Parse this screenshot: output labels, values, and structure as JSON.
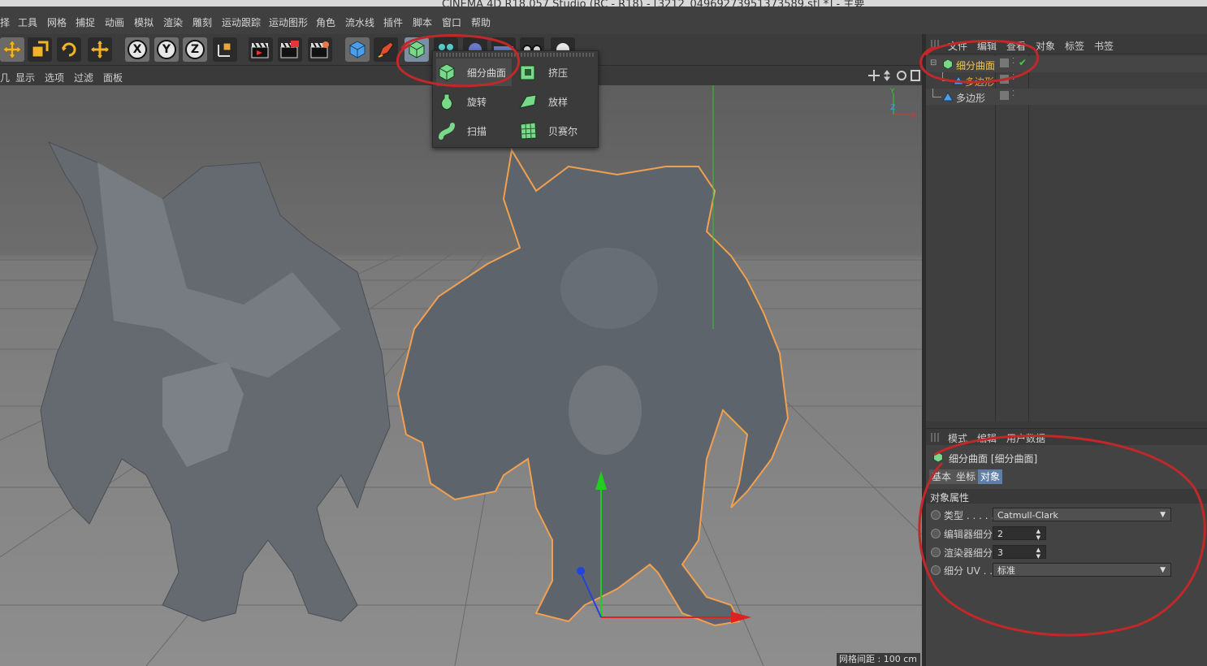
{
  "window": {
    "title": "CINEMA 4D R18.057 Studio (RC - R18) - [3212_04969273951373589.stl *] - 主要"
  },
  "menubar": {
    "items": [
      "择",
      "工具",
      "网格",
      "捕捉",
      "动画",
      "模拟",
      "渲染",
      "雕刻",
      "运动跟踪",
      "运动图形",
      "角色",
      "流水线",
      "插件",
      "脚本",
      "窗口",
      "帮助"
    ]
  },
  "viewport_menu": {
    "items": [
      "几",
      "显示",
      "选项",
      "过滤",
      "面板"
    ]
  },
  "popup": {
    "items": [
      {
        "label": "细分曲面",
        "icon": "subdivision-surface-icon"
      },
      {
        "label": "挤压",
        "icon": "extrude-icon"
      },
      {
        "label": "旋转",
        "icon": "lathe-icon"
      },
      {
        "label": "放样",
        "icon": "loft-icon"
      },
      {
        "label": "扫描",
        "icon": "sweep-icon"
      },
      {
        "label": "贝赛尔",
        "icon": "bezier-icon"
      }
    ]
  },
  "object_manager": {
    "menu": [
      "文件",
      "编辑",
      "查看",
      "对象",
      "标签",
      "书签"
    ],
    "objects": [
      {
        "label": "细分曲面",
        "color": "#f0c84a"
      },
      {
        "label": "多边形",
        "color": "#e0a040"
      },
      {
        "label": "多边形",
        "color": "#cfcfcf"
      }
    ]
  },
  "attribute_manager": {
    "menu": [
      "模式",
      "编辑",
      "用户数据"
    ],
    "object_title": "细分曲面 [细分曲面]",
    "tabs": [
      "基本",
      "坐标",
      "对象"
    ],
    "section_title": "对象属性",
    "properties": [
      {
        "label": "类型 . . . . .",
        "value": "Catmull-Clark",
        "kind": "dropdown"
      },
      {
        "label": "编辑器细分",
        "value": "2",
        "kind": "number"
      },
      {
        "label": "渲染器细分",
        "value": "3",
        "kind": "number"
      },
      {
        "label": "细分 UV . .",
        "value": "标准",
        "kind": "dropdown"
      }
    ]
  },
  "status": {
    "grid_spacing": "网格间距 : 100 cm"
  },
  "colors": {
    "accent": "#5f7fa8",
    "annotation": "#c0282a",
    "selection_outline": "#f0a050"
  }
}
